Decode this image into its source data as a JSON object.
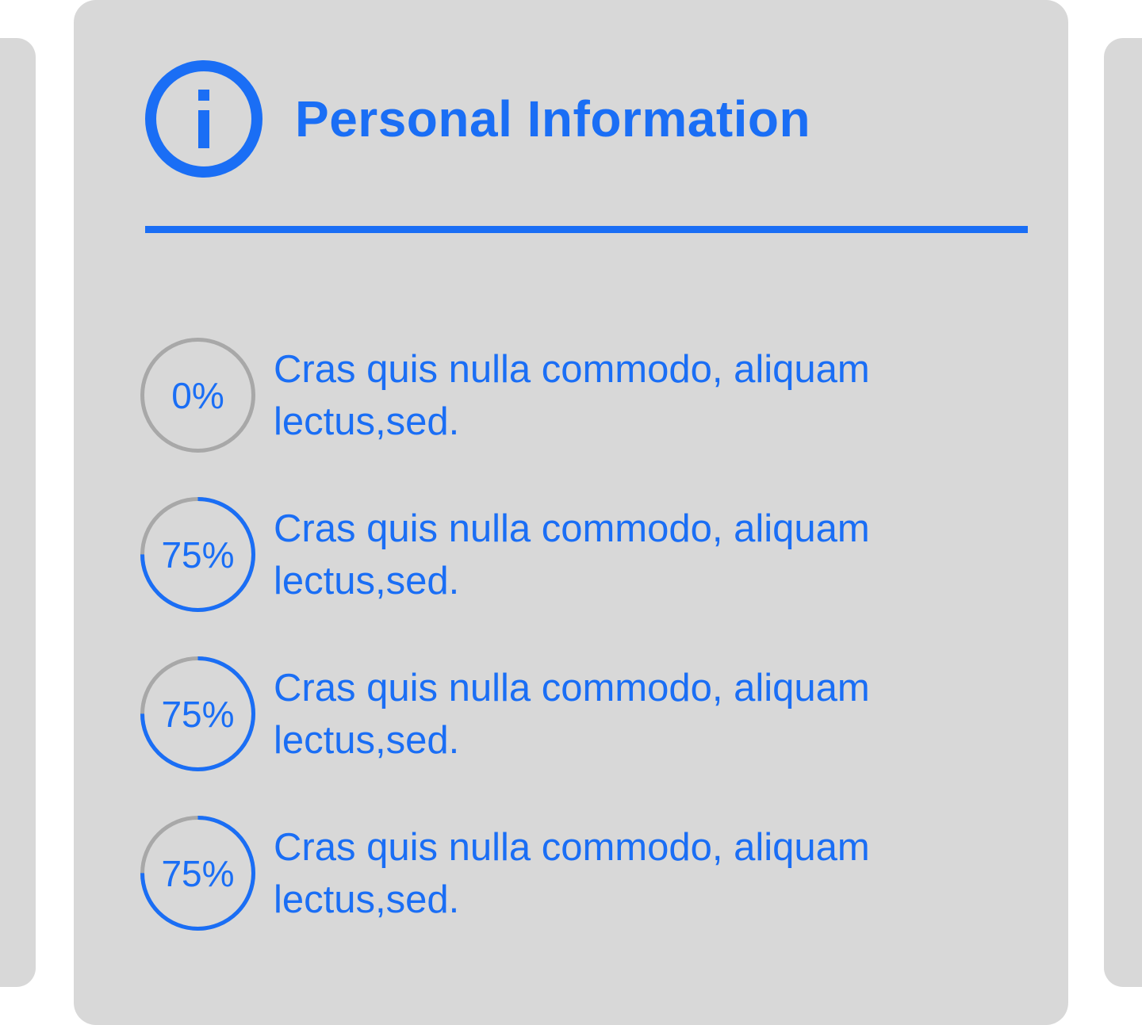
{
  "colors": {
    "accent": "#1a6ef5",
    "track": "#a8a8a8",
    "card_background": "#d8d8d8"
  },
  "card": {
    "icon": "info-icon",
    "title": "Personal Information",
    "items": [
      {
        "percent_label": "0%",
        "progress": 0,
        "text": "Cras quis nulla commodo, aliquam lectus,sed."
      },
      {
        "percent_label": "75%",
        "progress": 0.75,
        "text": "Cras quis nulla commodo, aliquam lectus,sed."
      },
      {
        "percent_label": "75%",
        "progress": 0.75,
        "text": "Cras quis nulla commodo, aliquam lectus,sed."
      },
      {
        "percent_label": "75%",
        "progress": 0.75,
        "text": "Cras quis nulla commodo, aliquam lectus,sed."
      }
    ]
  }
}
